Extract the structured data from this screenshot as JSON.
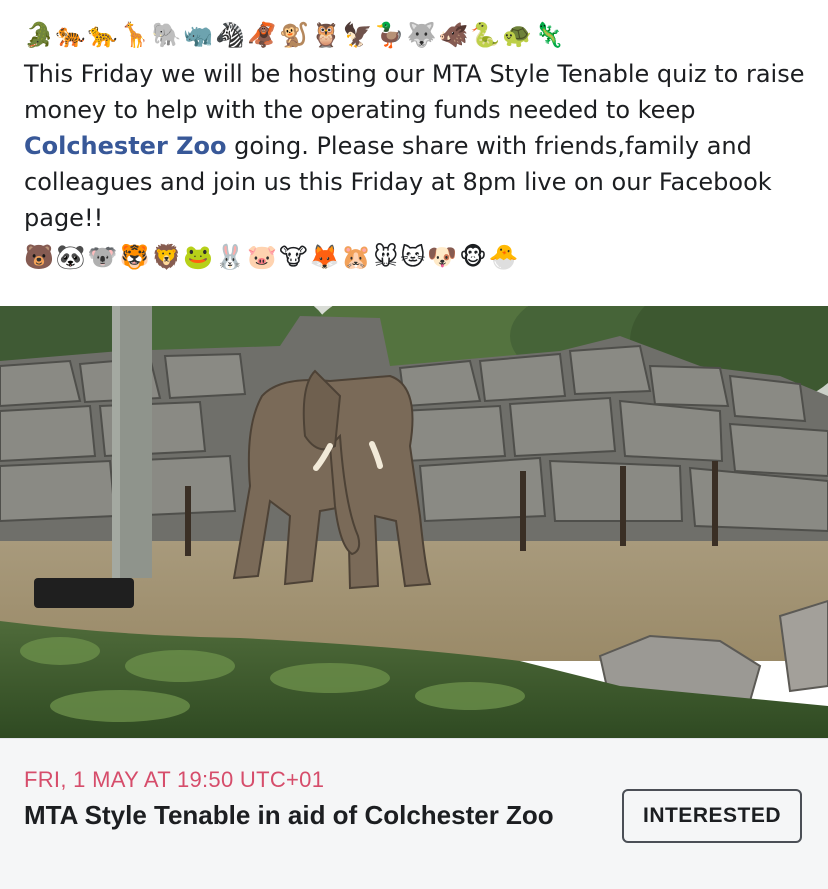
{
  "post": {
    "emoji_row_top": "🐊🐅🐆🦒🐘🦏🦓🦧🐒🦉🦅🦆🐺🐗🐍🐢🦎",
    "text_before_link": "This Friday we will be hosting our MTA Style Tenable quiz to raise money to help with the operating funds needed to keep ",
    "link_text": "Colchester Zoo",
    "text_after_link": " going. Please share with friends,family and colleagues and join us this Friday at 8pm live on our Facebook page!!",
    "emoji_row_bottom": "🐻🐼🐨🐯🦁🐸🐰🐷🐮🦊🐹🐭🐱🐶🐵🐣",
    "link_color": "#385898"
  },
  "event": {
    "date": "FRI, 1 MAY AT 19:50 UTC+01",
    "title": "MTA Style Tenable in aid of Colchester Zoo",
    "interested_label": "INTERESTED",
    "date_color": "#d64d6b",
    "card_background": "#f5f6f7"
  }
}
